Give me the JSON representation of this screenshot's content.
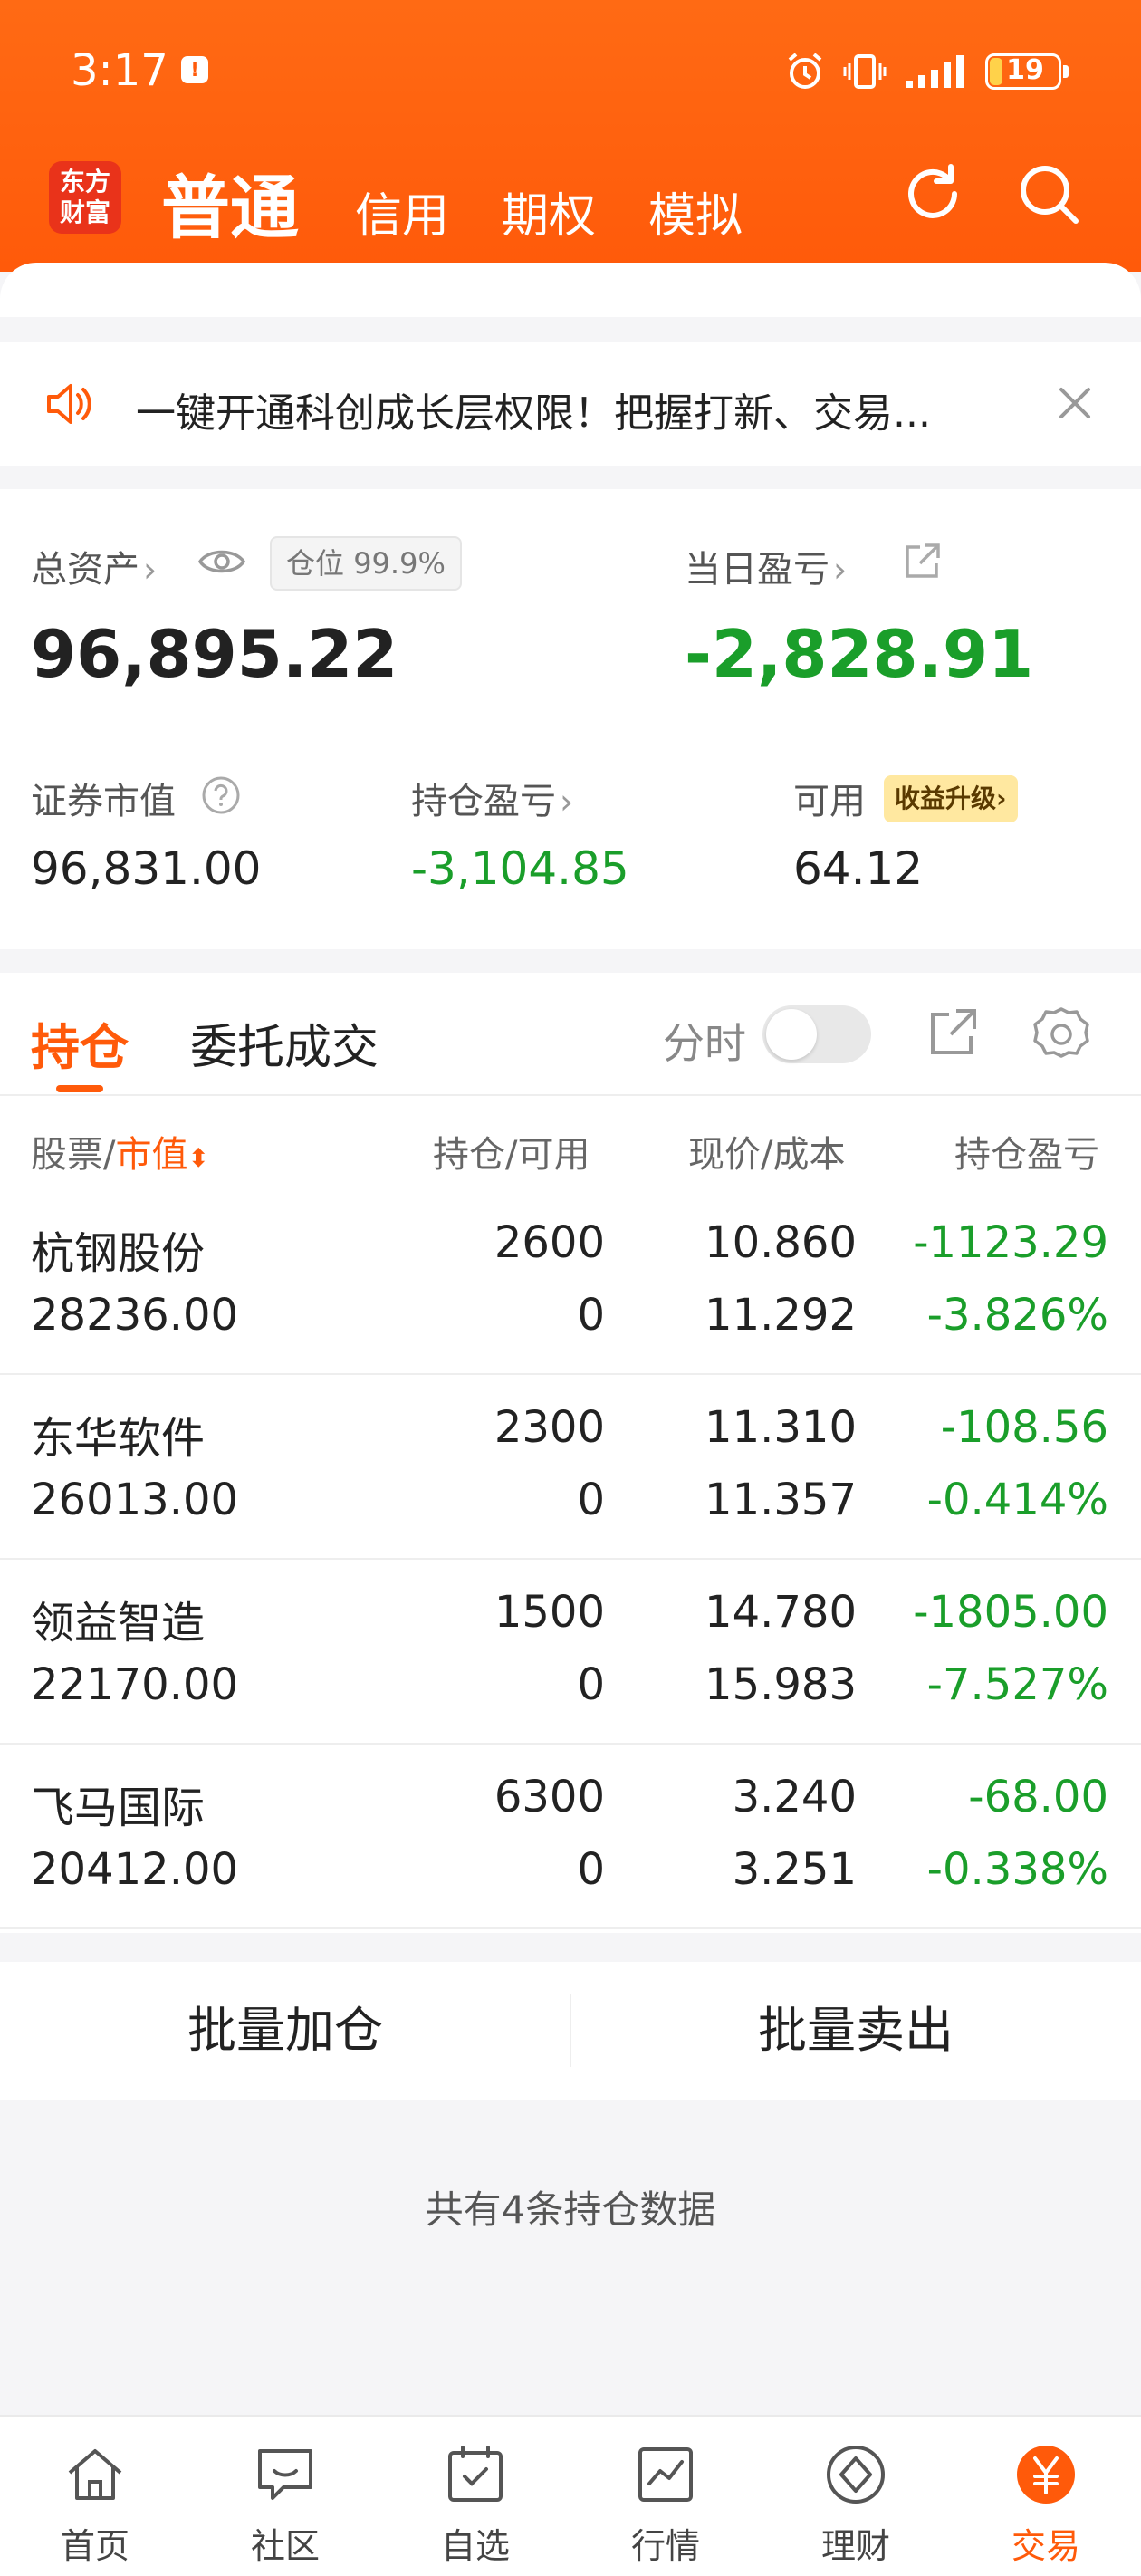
{
  "status_bar": {
    "time": "3:17",
    "battery": "19"
  },
  "nav": {
    "logo": "东方财富",
    "tabs": [
      {
        "label": "普通",
        "active": true
      },
      {
        "label": "信用"
      },
      {
        "label": "期权"
      },
      {
        "label": "模拟"
      }
    ]
  },
  "notice": {
    "text": "一键开通科创成长层权限！把握打新、交易..."
  },
  "assets": {
    "total_label": "总资产",
    "position_label": "仓位",
    "position_value": "99.9%",
    "total_value": "96,895.22",
    "daily_pl_label": "当日盈亏",
    "daily_pl_value": "-2,828.91",
    "market_value_label": "证券市值",
    "market_value": "96,831.00",
    "holding_pl_label": "持仓盈亏",
    "holding_pl_value": "-3,104.85",
    "available_label": "可用",
    "yield_badge": "收益升级",
    "available_value": "64.12"
  },
  "holdings": {
    "tab_active": "持仓",
    "tab_other": "委托成交",
    "time_share_label": "分时",
    "columns": {
      "stock": "股票",
      "sort_key": "市值",
      "qty": "持仓/可用",
      "price": "现价/成本",
      "pl": "持仓盈亏"
    },
    "rows": [
      {
        "name": "杭钢股份",
        "market_value": "28236.00",
        "qty": "2600",
        "available": "0",
        "price": "10.860",
        "cost": "11.292",
        "pl": "-1123.29",
        "pl_pct": "-3.826%"
      },
      {
        "name": "东华软件",
        "market_value": "26013.00",
        "qty": "2300",
        "available": "0",
        "price": "11.310",
        "cost": "11.357",
        "pl": "-108.56",
        "pl_pct": "-0.414%"
      },
      {
        "name": "领益智造",
        "market_value": "22170.00",
        "qty": "1500",
        "available": "0",
        "price": "14.780",
        "cost": "15.983",
        "pl": "-1805.00",
        "pl_pct": "-7.527%"
      },
      {
        "name": "飞马国际",
        "market_value": "20412.00",
        "qty": "6300",
        "available": "0",
        "price": "3.240",
        "cost": "3.251",
        "pl": "-68.00",
        "pl_pct": "-0.338%"
      }
    ]
  },
  "batch": {
    "add": "批量加仓",
    "sell": "批量卖出"
  },
  "summary": "共有4条持仓数据",
  "bottom_nav": [
    {
      "label": "首页",
      "icon": "home-icon"
    },
    {
      "label": "社区",
      "icon": "chat-icon"
    },
    {
      "label": "自选",
      "icon": "watchlist-icon"
    },
    {
      "label": "行情",
      "icon": "market-chart-icon"
    },
    {
      "label": "理财",
      "icon": "diamond-icon"
    },
    {
      "label": "交易",
      "icon": "yuan-icon",
      "active": true
    }
  ],
  "colors": {
    "accent": "#ff5a0a",
    "loss": "#1a9e2a"
  }
}
